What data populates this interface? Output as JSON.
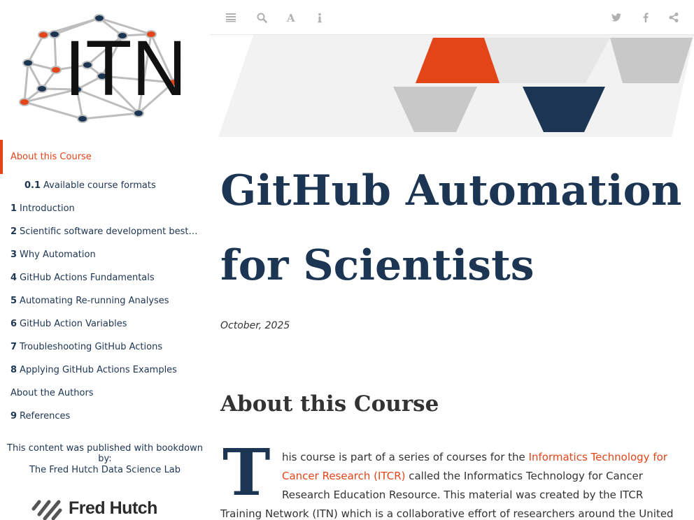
{
  "sidebar": {
    "logo_text": "ITN",
    "toc": [
      {
        "num": "",
        "label": "About this Course",
        "level": 1,
        "active": true
      },
      {
        "num": "0.1",
        "label": "Available course formats",
        "level": 2
      },
      {
        "num": "1",
        "label": "Introduction",
        "level": 1
      },
      {
        "num": "2",
        "label": "Scientific software development best …",
        "level": 1
      },
      {
        "num": "3",
        "label": "Why Automation",
        "level": 1
      },
      {
        "num": "4",
        "label": "GitHub Actions Fundamentals",
        "level": 1
      },
      {
        "num": "5",
        "label": "Automating Re-running Analyses",
        "level": 1
      },
      {
        "num": "6",
        "label": "GitHub Action Variables",
        "level": 1
      },
      {
        "num": "7",
        "label": "Troubleshooting GitHub Actions",
        "level": 1
      },
      {
        "num": "8",
        "label": "Applying GitHub Actions Examples",
        "level": 1
      },
      {
        "num": "",
        "label": "About the Authors",
        "level": 1
      },
      {
        "num": "9",
        "label": "References",
        "level": 1
      }
    ],
    "published_with": "This content was published with bookdown by:",
    "publisher": "The Fred Hutch Data Science Lab",
    "fh_logo_text": "Fred Hutch"
  },
  "toolbar": {
    "left_icons": [
      "toc-toggle-icon",
      "search-icon",
      "font-settings-icon",
      "info-icon"
    ],
    "right_icons": [
      "twitter-icon",
      "facebook-icon",
      "share-icon"
    ]
  },
  "content": {
    "title_line1": "GitHub Automation",
    "title_line2": "for Scientists",
    "date": "October, 2025",
    "section_heading": "About this Course",
    "dropcap": "T",
    "para_line1_pre": "his course is part of a series of courses for the ",
    "para_link_part1": "Informatics Technology for",
    "para_link_part2": "Cancer Research (ITCR)",
    "para_line2_post": " called the Informatics Technology for Cancer",
    "para_line3": "Research Education Resource. This material was created by the ITCR",
    "para_line4": "Training Network (ITN) which is a collaborative effort of researchers around the United"
  },
  "colors": {
    "accent": "#e34519",
    "navy": "#1c3553",
    "banner_gray": "#c8c8c8",
    "banner_light": "#e6e6e6",
    "banner_bg": "#f2f2f2"
  }
}
